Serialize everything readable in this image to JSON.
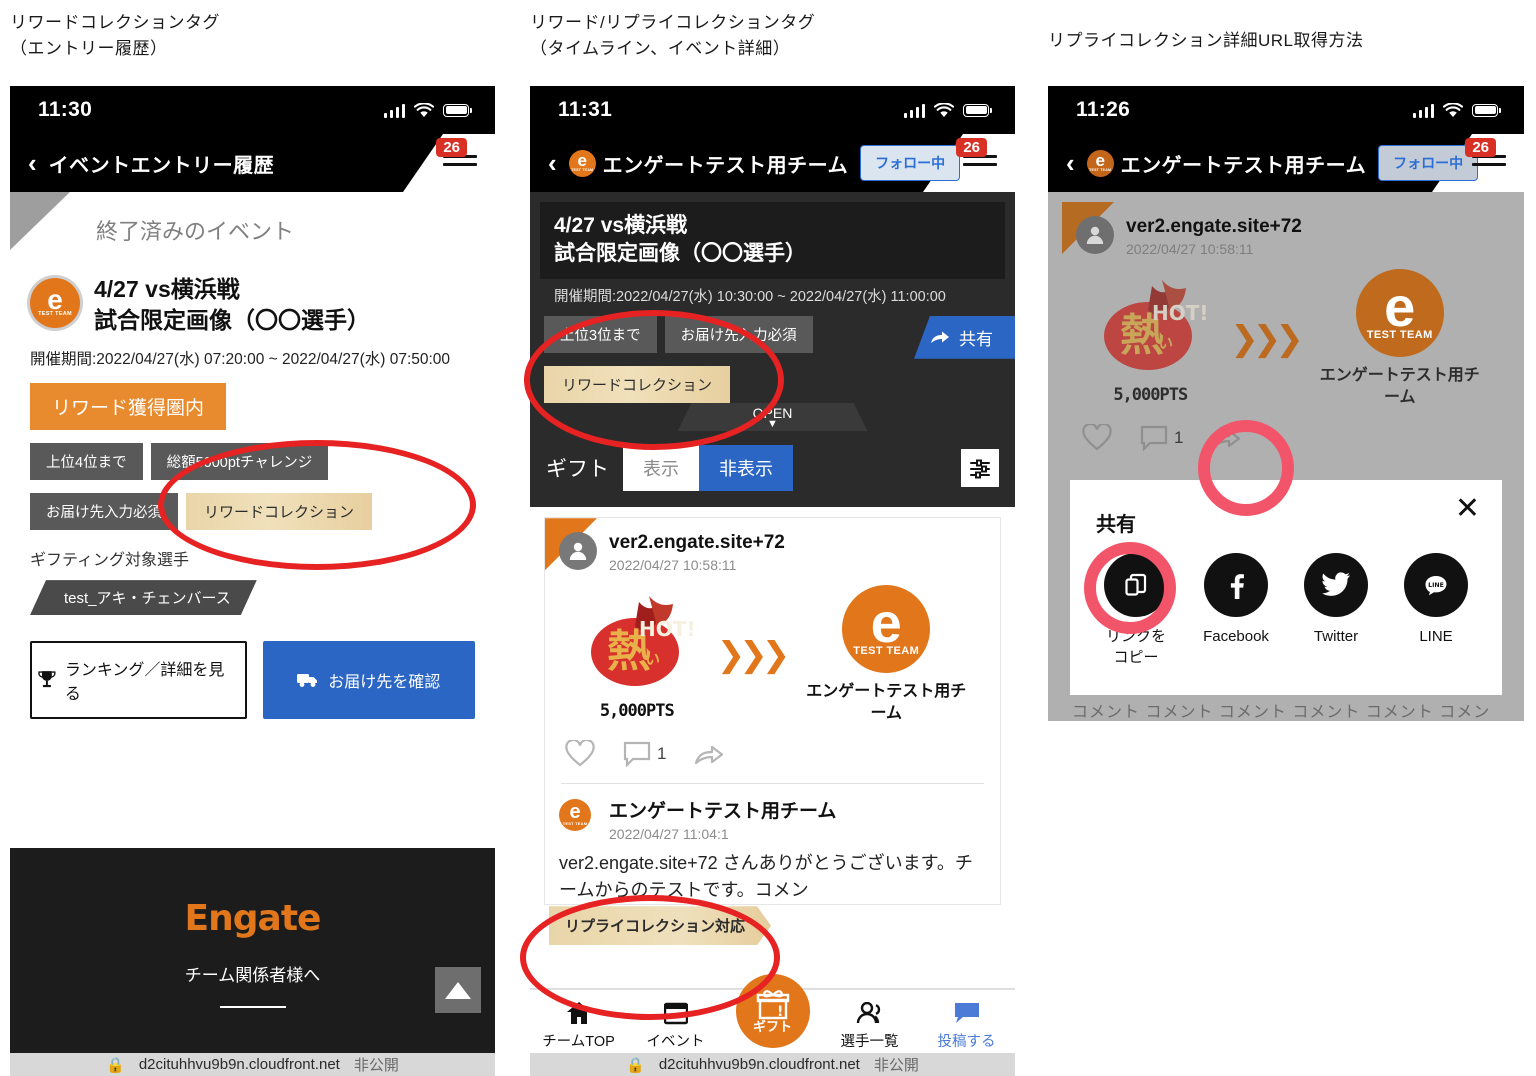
{
  "captions": {
    "panel1": "リワードコレクションタグ\n（エントリー履歴）",
    "panel2": "リワード/リプライコレクションタグ\n（タイムライン、イベント詳細）",
    "panel3": "リプライコレクション詳細URL取得方法"
  },
  "panel1": {
    "status": {
      "time": "11:30"
    },
    "nav": {
      "title": "イベントエントリー履歴",
      "badge": "26",
      "back_icon": "chevron-left-icon"
    },
    "section_title": "終了済みのイベント",
    "event": {
      "title_line1": "4/27  vs横浜戦",
      "title_line2": "試合限定画像（〇〇選手）",
      "period": "開催期間:2022/04/27(水) 07:20:00 ~ 2022/04/27(水) 07:50:00",
      "status_badge": "リワード獲得圏内",
      "tags": [
        "上位4位まで",
        "総額5000ptチャレンジ",
        "お届け先入力必須"
      ],
      "reward_tag": "リワードコレクション",
      "gifting_label": "ギフティング対象選手",
      "player": "test_アキ・チェンバース",
      "btn_ranking": "ランキング／詳細を見る",
      "btn_delivery": "お届け先を確認"
    },
    "footer": {
      "logo": "Engate",
      "subtitle": "チーム関係者様へ",
      "to_top_icon": "scroll-to-top-icon"
    },
    "urlbar": {
      "url": "d2cituhhvu9b9n.cloudfront.net",
      "label": "非公開"
    }
  },
  "panel2": {
    "status": {
      "time": "11:31"
    },
    "nav": {
      "title": "エンゲートテスト用チーム",
      "follow": "フォロー中",
      "badge": "26"
    },
    "event": {
      "title_line1": "4/27  vs横浜戦",
      "title_line2": "試合限定画像（〇〇選手）",
      "period": "開催期間:2022/04/27(水) 10:30:00 ~ 2022/04/27(水) 11:00:00",
      "tags": [
        "上位3位まで",
        "お届け先入力必須"
      ],
      "reward_tag": "リワードコレクション",
      "share": "共有",
      "open": "OPEN"
    },
    "gift_filter": {
      "label": "ギフト",
      "option_show": "表示",
      "option_hide": "非表示",
      "selected": "非表示",
      "filter_icon": "filter-settings-icon"
    },
    "post1": {
      "user": "ver2.engate.site+72",
      "time": "2022/04/27 10:58:11",
      "points": "5,000PTS",
      "team_caption": "エンゲートテスト用チーム",
      "team_logo_text": "TEST TEAM",
      "like_icon": "heart-icon",
      "comment_icon": "comment-icon",
      "comment_count": "1",
      "share_icon": "share-arrow-icon"
    },
    "post2": {
      "user": "エンゲートテスト用チーム",
      "time": "2022/04/27 11:04:1",
      "body": "ver2.engate.site+72 さんありがとうございます。チームからのテストです。コメン",
      "reply_tag": "リプライコレクション対応"
    },
    "tabbar": [
      {
        "label": "チームTOP",
        "icon": "home-icon"
      },
      {
        "label": "イベント",
        "icon": "calendar-icon"
      },
      {
        "label": "ギフト",
        "icon": "gift-icon"
      },
      {
        "label": "選手一覧",
        "icon": "people-icon"
      },
      {
        "label": "投稿する",
        "icon": "post-icon"
      }
    ],
    "urlbar": {
      "url": "d2cituhhvu9b9n.cloudfront.net",
      "label": "非公開"
    }
  },
  "panel3": {
    "status": {
      "time": "11:26"
    },
    "nav": {
      "title": "エンゲートテスト用チーム",
      "follow": "フォロー中",
      "badge": "26"
    },
    "post": {
      "user": "ver2.engate.site+72",
      "time": "2022/04/27 10:58:11",
      "points": "5,000PTS",
      "team_caption": "エンゲートテスト用チーム",
      "team_logo_text": "TEST TEAM",
      "comment_count": "1"
    },
    "share_sheet": {
      "title": "共有",
      "close_icon": "close-icon",
      "items": [
        {
          "label": "リンクを\nコピー",
          "icon": "copy-link-icon"
        },
        {
          "label": "Facebook",
          "icon": "facebook-icon"
        },
        {
          "label": "Twitter",
          "icon": "twitter-icon"
        },
        {
          "label": "LINE",
          "icon": "line-icon"
        }
      ]
    },
    "ghost_text": "コメント コメント コメント コメント コメント コメン"
  },
  "colors": {
    "orange": "#E2761B",
    "blue": "#2b66c4",
    "annotation_red": "#e62222",
    "annotation_pink": "#f2556a",
    "tag_tan": "#e9d5a8"
  }
}
